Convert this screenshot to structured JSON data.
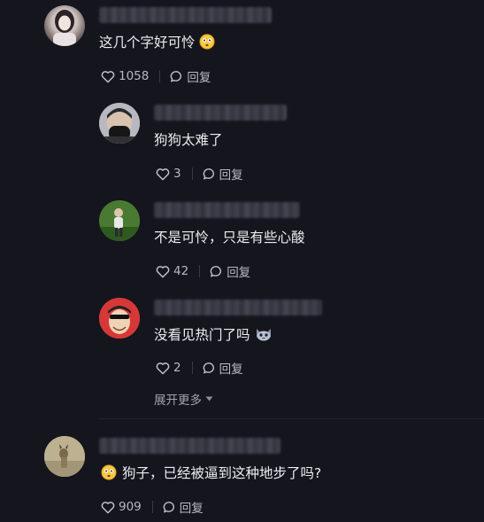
{
  "comments": [
    {
      "text": "这几个字好可怜",
      "emoji_icon": "flushed-face-icon",
      "likes": "1058",
      "reply_label": "回复"
    },
    {
      "text": "狗狗太难了",
      "likes": "3",
      "reply_label": "回复"
    },
    {
      "text": "不是可怜，只是有些心酸",
      "likes": "42",
      "reply_label": "回复"
    },
    {
      "text": "没看见热门了吗",
      "emoji_icon": "cat-face-icon",
      "likes": "2",
      "reply_label": "回复"
    },
    {
      "text": "狗子，已经被逼到这种地步了吗?",
      "emoji_icon": "flushed-face-icon",
      "likes": "909",
      "reply_label": "回复"
    }
  ],
  "expand_label": "展开更多",
  "colors": {
    "background": "#15151d",
    "text": "#ececf0",
    "secondary_text": "#b8b8c0"
  }
}
